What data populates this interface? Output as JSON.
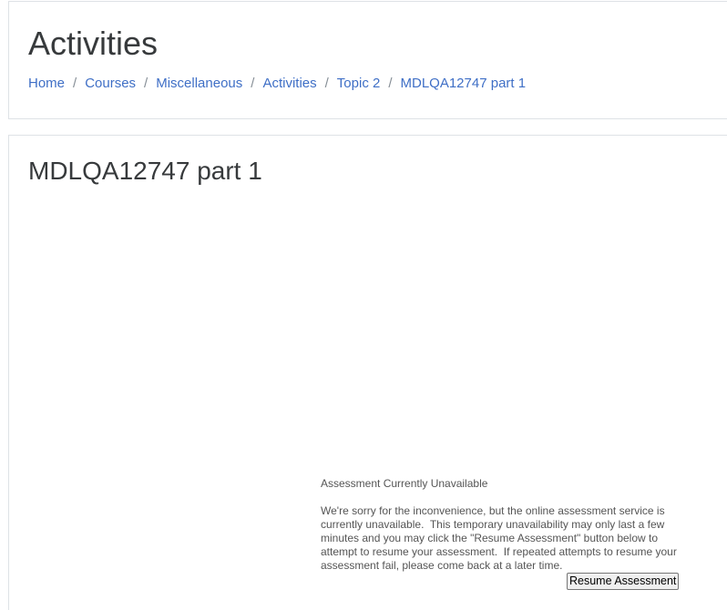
{
  "header": {
    "title": "Activities",
    "breadcrumbs": [
      {
        "label": "Home"
      },
      {
        "label": "Courses"
      },
      {
        "label": "Miscellaneous"
      },
      {
        "label": "Activities"
      },
      {
        "label": "Topic 2"
      },
      {
        "label": "MDLQA12747 part 1"
      }
    ],
    "separator": "/"
  },
  "main": {
    "activity_title": "MDLQA12747 part 1",
    "notice": {
      "heading": "Assessment Currently Unavailable",
      "body": "We're sorry for the inconvenience, but the online assessment service is currently unavailable.  This temporary unavailability may only last a few minutes and you may click the \"Resume Assessment\" button below to attempt to resume your assessment.  If repeated attempts to resume your assessment fail, please come back at a later time.",
      "button_label": "Resume Assessment"
    }
  },
  "colors": {
    "link": "#3f6fc6",
    "text": "#373a3c",
    "border": "#dee2e6"
  }
}
